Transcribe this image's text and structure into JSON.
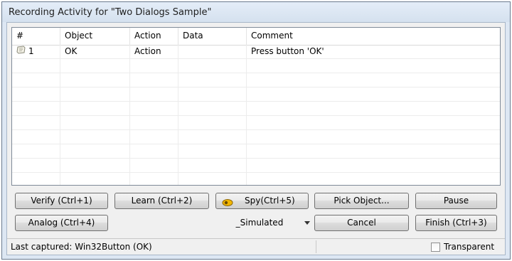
{
  "window": {
    "title": "Recording Activity for \"Two Dialogs Sample\""
  },
  "grid": {
    "columns": [
      "#",
      "Object",
      "Action",
      "Data",
      "Comment"
    ],
    "rows": [
      {
        "num": "1",
        "object": "OK",
        "action": "Action",
        "data": "",
        "comment": "Press button 'OK'",
        "icon": "script-icon"
      }
    ]
  },
  "buttons": {
    "verify": "Verify (Ctrl+1)",
    "learn": "Learn (Ctrl+2)",
    "spy": "Spy(Ctrl+5)",
    "pick_object": "Pick Object...",
    "pause": "Pause",
    "analog": "Analog (Ctrl+4)",
    "cancel": "Cancel",
    "finish": "Finish (Ctrl+3)"
  },
  "mode_select": {
    "value": "_Simulated"
  },
  "status": {
    "text": "Last captured: Win32Button (OK)",
    "transparent_label": "Transparent",
    "transparent_checked": false
  },
  "colors": {
    "window_frame": "#dde7f3",
    "client_bg": "#f0f0f0"
  }
}
